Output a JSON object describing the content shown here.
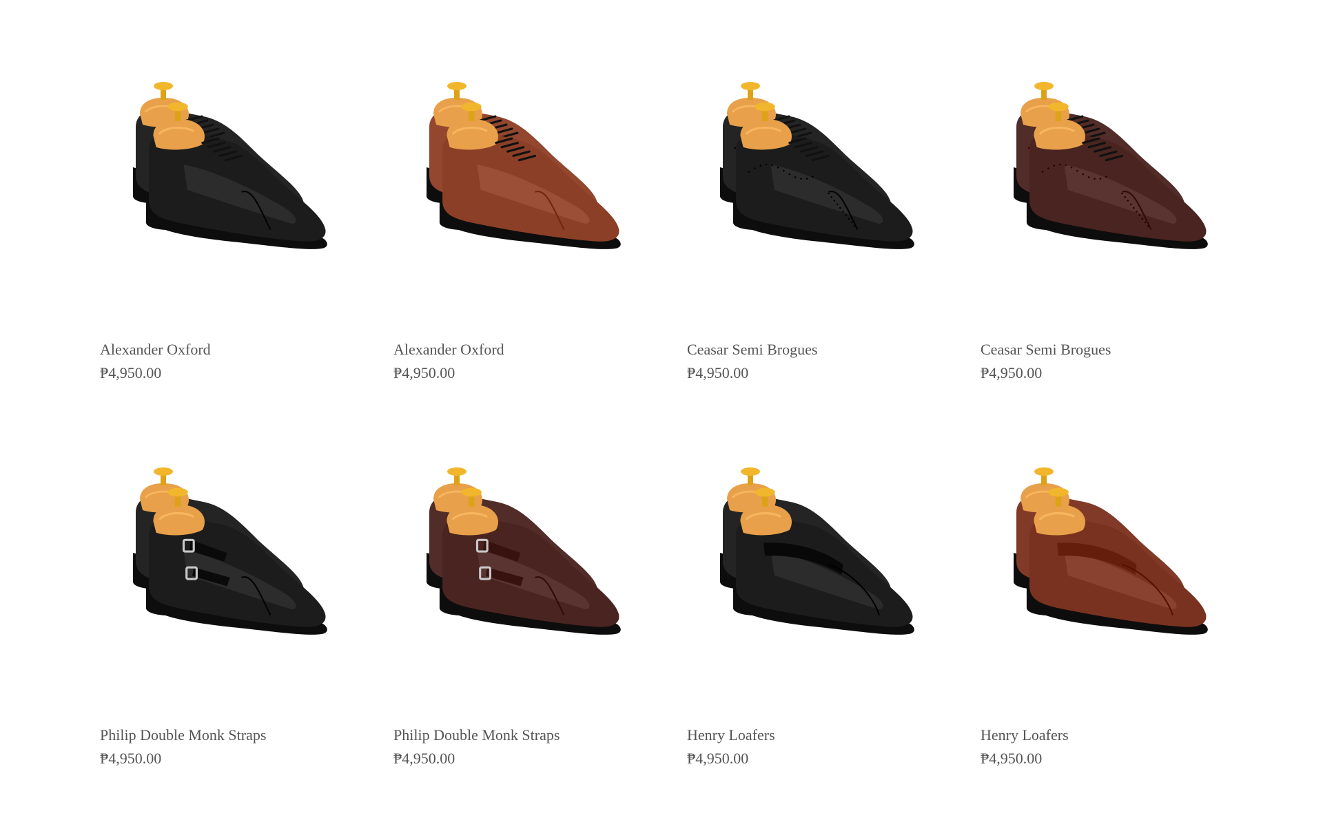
{
  "products": [
    {
      "name": "Alexander Oxford",
      "price": "₱4,950.00",
      "style": "oxford",
      "color": "#1c1c1c",
      "image_label": "black-oxford-shoe-icon"
    },
    {
      "name": "Alexander Oxford",
      "price": "₱4,950.00",
      "style": "oxford",
      "color": "#8b3f26",
      "image_label": "brown-oxford-shoe-icon"
    },
    {
      "name": "Ceasar Semi Brogues",
      "price": "₱4,950.00",
      "style": "brogue",
      "color": "#1c1c1c",
      "image_label": "black-brogue-shoe-icon"
    },
    {
      "name": "Ceasar Semi Brogues",
      "price": "₱4,950.00",
      "style": "brogue",
      "color": "#4a2420",
      "image_label": "burgundy-brogue-shoe-icon"
    },
    {
      "name": "Philip Double Monk Straps",
      "price": "₱4,950.00",
      "style": "monk",
      "color": "#1c1c1c",
      "image_label": "black-monk-strap-shoe-icon"
    },
    {
      "name": "Philip Double Monk Straps",
      "price": "₱4,950.00",
      "style": "monk",
      "color": "#4a2420",
      "image_label": "burgundy-monk-strap-shoe-icon"
    },
    {
      "name": "Henry Loafers",
      "price": "₱4,950.00",
      "style": "loafer",
      "color": "#1c1c1c",
      "image_label": "black-loafer-shoe-icon"
    },
    {
      "name": "Henry Loafers",
      "price": "₱4,950.00",
      "style": "loafer",
      "color": "#7a3220",
      "image_label": "brown-loafer-shoe-icon"
    }
  ],
  "colors": {
    "text": "#555555",
    "shoe_tree": "#e8a04a",
    "shoe_tree_knob": "#f2b62c",
    "sole": "#0d0d0d"
  }
}
